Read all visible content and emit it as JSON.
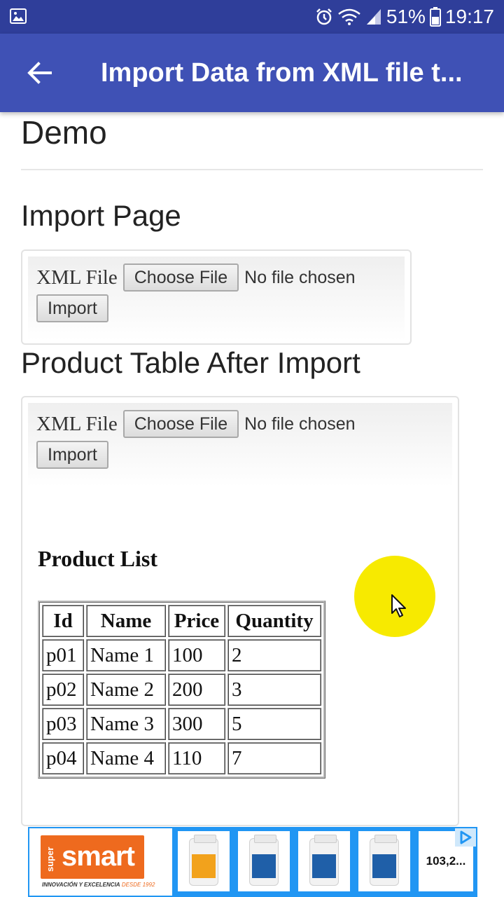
{
  "status_bar": {
    "battery": "51%",
    "time": "19:17",
    "icons": [
      "gallery-icon",
      "alarm-icon",
      "wifi-icon",
      "signal-icon",
      "battery-icon"
    ]
  },
  "app_bar": {
    "title": "Import Data from XML file t...",
    "back_icon": "arrow-back-icon"
  },
  "article": {
    "heading_demo": "Demo",
    "heading_import": "Import Page",
    "heading_product": "Product Table After Import"
  },
  "import_page_shot": {
    "field_label": "XML File",
    "choose_button": "Choose File",
    "no_file_text": "No file chosen",
    "import_button": "Import"
  },
  "product_shot": {
    "field_label": "XML File",
    "choose_button": "Choose File",
    "no_file_text": "No file chosen",
    "import_button": "Import",
    "list_title": "Product List",
    "columns": [
      "Id",
      "Name",
      "Price",
      "Quantity"
    ],
    "rows": [
      [
        "p01",
        "Name 1",
        "100",
        "2"
      ],
      [
        "p02",
        "Name 2",
        "200",
        "3"
      ],
      [
        "p03",
        "Name 3",
        "300",
        "5"
      ],
      [
        "p04",
        "Name 4",
        "110",
        "7"
      ]
    ],
    "cursor_highlight_color": "#f7ea00"
  },
  "ad": {
    "brand_small": "super",
    "brand": "smart",
    "tagline": "INNOVACIÓN Y EXCELENCIA",
    "tagline_accent": "DESDE 1992",
    "price": "103,2...",
    "accent_color": "#2196f3"
  },
  "colors": {
    "status_bar": "#2f3e9a",
    "app_bar": "#3f51b5"
  }
}
